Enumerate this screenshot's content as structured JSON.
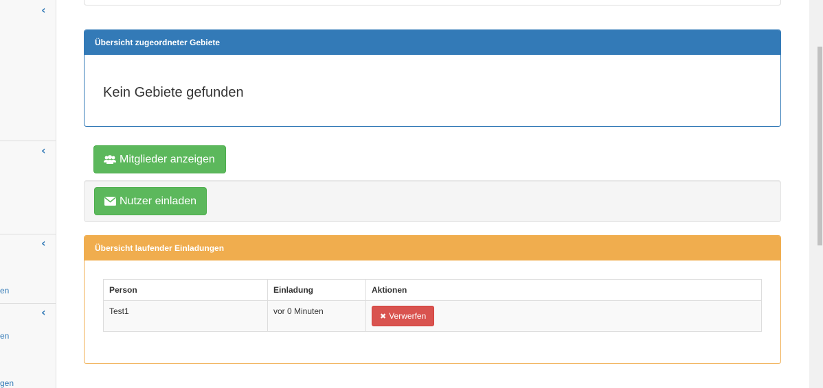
{
  "sidebar": {
    "sections": [
      {
        "text": ""
      },
      {
        "text": ""
      },
      {
        "text": "en"
      },
      {
        "text": "en",
        "text2": "gen"
      }
    ]
  },
  "areas_panel": {
    "title": "Übersicht zugeordneter Gebiete",
    "empty_message": "Kein Gebiete gefunden"
  },
  "members_button": {
    "label": "Mitglieder anzeigen",
    "icon": "users-icon"
  },
  "invite_button": {
    "label": "Nutzer einladen",
    "icon": "envelope-icon"
  },
  "invitations_panel": {
    "title": "Übersicht laufender Einladungen",
    "columns": [
      "Person",
      "Einladung",
      "Aktionen"
    ],
    "rows": [
      {
        "person": "Test1",
        "invitation": "vor 0 Minuten",
        "action_label": "Verwerfen"
      }
    ]
  },
  "colors": {
    "primary": "#337ab7",
    "success": "#5cb85c",
    "warning": "#f0ad4e",
    "danger": "#d9534f"
  }
}
